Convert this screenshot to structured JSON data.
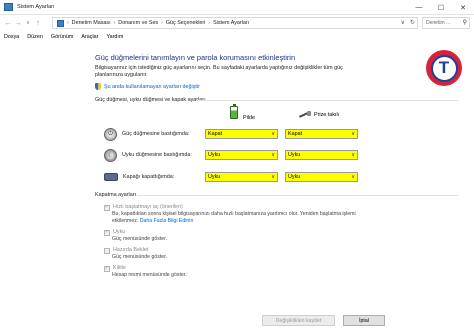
{
  "window": {
    "title": "Sistem Ayarları",
    "controls": {
      "minimize": "—",
      "maximize": "☐",
      "close": "✕"
    }
  },
  "address": {
    "back": "←",
    "forward": "→",
    "up": "↑",
    "breadcrumbs": [
      "Denetim Masası",
      "Donanım ve Ses",
      "Güç Seçenekleri",
      "Sistem Ayarları"
    ],
    "separator": "›",
    "dropdown": "∨",
    "refresh": "↻",
    "search_placeholder": "Denetim ..."
  },
  "menubar": {
    "items": [
      "Dosya",
      "Düzen",
      "Görünüm",
      "Araçlar",
      "Yardım"
    ]
  },
  "main": {
    "title": "Güç düğmelerini tanımlayın ve parola korumasını etkinleştirin",
    "description": "Bilgisayarınız için istediğiniz güç ayarlarını seçin. Bu sayfadaki ayarlarda yaptığınız değişiklikler tüm güç planlarınıza uygulanır.",
    "unavailable_link": "Şu anda kullanılamayan ayarları değiştir",
    "buttons_section": "Güç düğmesi, uyku düğmesi ve kapak ayarları",
    "col_battery": "Pilde",
    "col_plugged": "Prize takılı",
    "rows": [
      {
        "label": "Güç düğmesine bastığımda:",
        "battery": "Kapat",
        "plugged": "Kapat"
      },
      {
        "label": "Uyku düğmesine bastığımda:",
        "battery": "Uyku",
        "plugged": "Uyku"
      },
      {
        "label": "Kapağı kapattığımda:",
        "battery": "Uyku",
        "plugged": "Uyku"
      }
    ],
    "shutdown_section": "Kapatma ayarları",
    "shutdown_items": [
      {
        "label": "Hızlı başlatmayı aç (önerilen)",
        "checked": true,
        "desc": "Bu, kapattıktan sonra kişisel bilgisayarınızı daha hızlı başlatmanıza yardımcı olur. Yeniden başlatma işlemi etkilenmez.",
        "desc_link": "Daha Fazla Bilgi Edinin"
      },
      {
        "label": "Uyku",
        "checked": true,
        "desc": "Güç menüsünde göster.",
        "desc_link": ""
      },
      {
        "label": "Hazırda Beklet",
        "checked": false,
        "desc": "Güç menüsünde göster.",
        "desc_link": ""
      },
      {
        "label": "Kilitle",
        "checked": true,
        "desc": "Hesap resmi menüsünde göster.",
        "desc_link": ""
      }
    ]
  },
  "footer": {
    "save_label": "Değişiklikleri kaydet",
    "cancel_label": "İptal"
  },
  "colors": {
    "select_bg": "#ffff00",
    "title_color": "#1e3287",
    "link_color": "#0066cc",
    "logo_red": "#d6233d",
    "logo_blue": "#1f3f97"
  },
  "logo_letter": "T",
  "caret": "∨",
  "check_mark": "✓"
}
